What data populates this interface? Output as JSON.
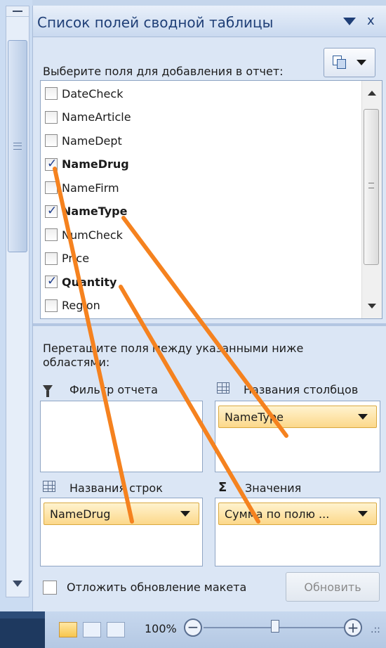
{
  "pane": {
    "title": "Список полей сводной таблицы",
    "close_glyph": "x",
    "choose_label": "Выберите поля для добавления в отчет:",
    "layout_icon": "field-list-layout-icon"
  },
  "fields": [
    {
      "label": "DateCheck",
      "checked": false,
      "bold": false
    },
    {
      "label": "NameArticle",
      "checked": false,
      "bold": false
    },
    {
      "label": "NameDept",
      "checked": false,
      "bold": false
    },
    {
      "label": "NameDrug",
      "checked": true,
      "bold": true
    },
    {
      "label": "NameFirm",
      "checked": false,
      "bold": false
    },
    {
      "label": "NameType",
      "checked": true,
      "bold": true
    },
    {
      "label": "NumCheck",
      "checked": false,
      "bold": false
    },
    {
      "label": "Price",
      "checked": false,
      "bold": false
    },
    {
      "label": "Quantity",
      "checked": true,
      "bold": true
    },
    {
      "label": "Region",
      "checked": false,
      "bold": false
    }
  ],
  "areas": {
    "drag_label": "Перетащите поля между указанными ниже областями:",
    "report_filter": {
      "title": "Фильтр отчета",
      "icon": "filter-icon"
    },
    "column_labels": {
      "title": "Названия столбцов",
      "icon": "table-grid-icon",
      "chip": "NameType"
    },
    "row_labels": {
      "title": "Названия строк",
      "icon": "table-grid-icon",
      "chip": "NameDrug"
    },
    "values": {
      "title": "Значения",
      "icon": "sigma-icon",
      "sigma": "Σ",
      "chip": "Сумма по полю ..."
    }
  },
  "footer": {
    "defer_label": "Отложить обновление макета",
    "defer_checked": false,
    "update_button": "Обновить"
  },
  "status_bar": {
    "zoom": "100%",
    "minus": "−",
    "plus": "+",
    "grip": ".::"
  },
  "annotation_color": "#f5821f"
}
